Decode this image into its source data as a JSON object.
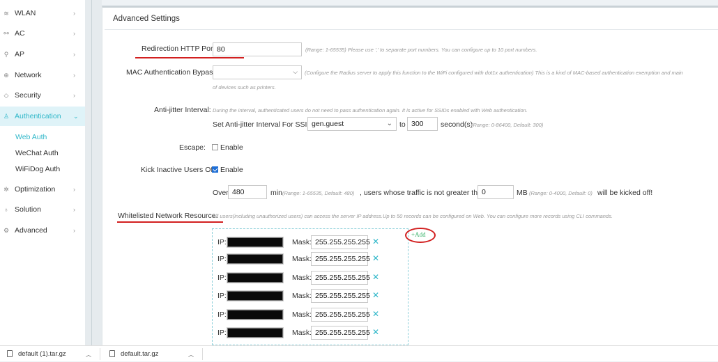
{
  "sidebar": {
    "items": [
      {
        "label": "WLAN",
        "icon": "wifi-icon"
      },
      {
        "label": "AC",
        "icon": "ac-icon"
      },
      {
        "label": "AP",
        "icon": "ap-icon"
      },
      {
        "label": "Network",
        "icon": "globe-icon"
      },
      {
        "label": "Security",
        "icon": "shield-icon"
      },
      {
        "label": "Authentication",
        "icon": "user-icon"
      },
      {
        "label": "Optimization",
        "icon": "optimization-icon"
      },
      {
        "label": "Solution",
        "icon": "bulb-icon"
      },
      {
        "label": "Advanced",
        "icon": "gear-icon"
      }
    ],
    "sub_items": [
      {
        "label": "Web Auth"
      },
      {
        "label": "WeChat Auth"
      },
      {
        "label": "WiFiDog Auth"
      }
    ],
    "active_item": "Authentication",
    "active_sub_item": "Web Auth"
  },
  "panel": {
    "title": "Advanced Settings"
  },
  "form": {
    "redirection_port": {
      "label": "Redirection HTTP Port:",
      "value": "80",
      "hint": "(Range: 1-65535) Please use ',' to separate port numbers. You can configure up to 10 port numbers."
    },
    "mac_bypass": {
      "label": "MAC Authentication Bypass:",
      "value": "",
      "hint": "(Configure the Radius server to apply this function to the WiFi configured with dot1x authentication) This is a kind of MAC-based authentication exemption and main",
      "hint2": "of devices such as printers."
    },
    "anti_jitter": {
      "label": "Anti-jitter Interval:",
      "desc": "During the interval, authenticated users do not need to pass authentication again. It is active for SSIDs enabled with Web authentication.",
      "ssid_label": "Set Anti-jitter Interval For SSID:",
      "ssid_value": "gen.guest",
      "to_text": "to",
      "seconds_value": "300",
      "seconds_unit": "second(s)",
      "seconds_hint": "(Range: 0-86400, Default: 300)"
    },
    "escape": {
      "label": "Escape:",
      "checkbox_label": "Enable",
      "checked": false
    },
    "kick_inactive": {
      "label": "Kick Inactive Users Off:",
      "checkbox_label": "Enable",
      "checked": true,
      "over_text": "Over",
      "minutes_value": "480",
      "min_text": "min",
      "min_hint": "(Range: 1-65535, Default: 480)",
      "traffic_text": ", users whose traffic is not greater than",
      "traffic_value": "0",
      "mb_text": "MB",
      "mb_hint": "(Range: 0-4000, Default: 0)",
      "kicked_text": "will be kicked off!"
    },
    "whitelist": {
      "label": "Whitelisted Network Resource:",
      "hint": "All users(including unauthorized users) can access the server IP address.Up to 50 records can be configured on Web. You can configure more records using CLI commands.",
      "ip_label": "IP:",
      "mask_label": "Mask:",
      "add_label": "+Add",
      "rows": [
        {
          "mask": "255.255.255.255"
        },
        {
          "mask": "255.255.255.255"
        },
        {
          "mask": "255.255.255.255"
        },
        {
          "mask": "255.255.255.255"
        },
        {
          "mask": "255.255.255.255"
        },
        {
          "mask": "255.255.255.255"
        }
      ]
    }
  },
  "downloads": [
    {
      "name": "default (1).tar.gz"
    },
    {
      "name": "default.tar.gz"
    }
  ],
  "colors": {
    "accent": "#2fb7c9",
    "annotation": "#d21f1f",
    "add": "#3bb36b",
    "checkbox_on": "#1f6fd6"
  }
}
